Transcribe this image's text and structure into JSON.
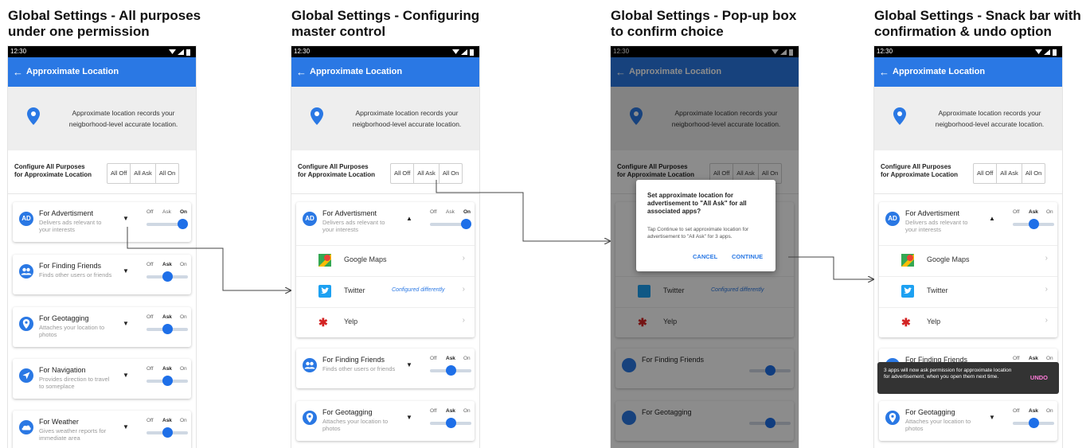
{
  "panels": [
    {
      "title": "Global Settings - All purposes\nunder one permission",
      "time": "12:30",
      "app_title": "Approximate Location",
      "banner_text": "Approximate location records your neigborhood-level accurate location.",
      "config_label": "Configure All Purposes for Approximate Location",
      "segments": [
        "All Off",
        "All Ask",
        "All On"
      ],
      "cards": [
        {
          "avatar": "AD",
          "title": "For Advertisment",
          "subtitle": "Delivers ads relevant to your interests",
          "chevron": "▼",
          "toggle": [
            "Off",
            "Ask",
            "On"
          ],
          "state": "On"
        },
        {
          "avatar": "people-icon",
          "title": "For Finding Friends",
          "subtitle": "Finds other users or friends",
          "chevron": "▼",
          "toggle": [
            "Off",
            "Ask",
            "On"
          ],
          "state": "Ask"
        },
        {
          "avatar": "pin-icon",
          "title": "For Geotagging",
          "subtitle": "Attaches your location to photos",
          "chevron": "▼",
          "toggle": [
            "Off",
            "Ask",
            "On"
          ],
          "state": "Ask"
        },
        {
          "avatar": "navigation-icon",
          "title": "For Navigation",
          "subtitle": "Provides direction to travel to someplace",
          "chevron": "▼",
          "toggle": [
            "Off",
            "Ask",
            "On"
          ],
          "state": "Ask"
        },
        {
          "avatar": "cloud-icon",
          "title": "For Weather",
          "subtitle": "Gives weather reports for immediate area",
          "chevron": "▼",
          "toggle": [
            "Off",
            "Ask",
            "On"
          ],
          "state": "Ask"
        }
      ]
    },
    {
      "title": "Global Settings - Configuring\nmaster control",
      "time": "12:30",
      "app_title": "Approximate Location",
      "banner_text": "Approximate location records your neigborhood-level accurate location.",
      "config_label": "Configure All Purposes for Approximate Location",
      "segments": [
        "All Off",
        "All Ask",
        "All On"
      ],
      "cards": [
        {
          "avatar": "AD",
          "title": "For Advertisment",
          "subtitle": "Delivers ads relevant to your interests",
          "chevron": "▲",
          "toggle": [
            "Off",
            "Ask",
            "On"
          ],
          "state": "On"
        },
        {
          "avatar": "people-icon",
          "title": "For Finding Friends",
          "subtitle": "Finds other users or friends",
          "chevron": "▼",
          "toggle": [
            "Off",
            "Ask",
            "On"
          ],
          "state": "Ask"
        },
        {
          "avatar": "pin-icon",
          "title": "For Geotagging",
          "subtitle": "Attaches your location to photos",
          "chevron": "▼",
          "toggle": [
            "Off",
            "Ask",
            "On"
          ],
          "state": "Ask"
        }
      ],
      "apps": [
        {
          "name": "Google Maps",
          "note": ""
        },
        {
          "name": "Twitter",
          "note": "Configured differently"
        },
        {
          "name": "Yelp",
          "note": ""
        }
      ]
    },
    {
      "title": "Global Settings - Pop-up box\nto confirm choice",
      "time": "12:30",
      "app_title": "Approximate Location",
      "banner_text": "Approximate location records your neigborhood-level accurate location.",
      "config_label": "Configure All Purposes for Approximate Location",
      "segments": [
        "All Off",
        "All Ask",
        "All On"
      ],
      "dialog": {
        "title": "Set approximate location for advertisement to \"All Ask\" for all associated apps?",
        "body": "Tap Continue to set approximate location for advertisement to \"All Ask\" for 3 apps.",
        "cancel": "CANCEL",
        "continue": "CONTINUE"
      },
      "bg_items": [
        "Twitter",
        "Configured differently",
        "Yelp",
        "For Finding Friends",
        "For Geotagging"
      ]
    },
    {
      "title": "Global Settings - Snack bar with\nconfirmation & undo option",
      "time": "12:30",
      "app_title": "Approximate Location",
      "banner_text": "Approximate location records your neigborhood-level accurate location.",
      "config_label": "Configure All Purposes for Approximate Location",
      "segments": [
        "All Off",
        "All Ask",
        "All On"
      ],
      "cards": [
        {
          "avatar": "AD",
          "title": "For Advertisment",
          "subtitle": "Delivers ads relevant to your interests",
          "chevron": "▲",
          "toggle": [
            "Off",
            "Ask",
            "On"
          ],
          "state": "Ask"
        },
        {
          "avatar": "people-icon",
          "title": "For Finding Friends",
          "toggle": [
            "Off",
            "Ask",
            "On"
          ],
          "state": "Ask"
        },
        {
          "avatar": "pin-icon",
          "title": "For Geotagging",
          "subtitle": "Attaches your location to photos",
          "chevron": "▼",
          "toggle": [
            "Off",
            "Ask",
            "On"
          ],
          "state": "Ask"
        }
      ],
      "apps": [
        {
          "name": "Google Maps"
        },
        {
          "name": "Twitter"
        },
        {
          "name": "Yelp"
        }
      ],
      "snackbar": {
        "text": "3 apps will now ask permission for approximate location for advertisement, when you open them next time.",
        "undo": "UNDO"
      }
    }
  ],
  "colors": {
    "primary": "#2a78e4",
    "knob": "#1e6fe8",
    "undo": "#ff7ad9",
    "snackbar": "#333333"
  }
}
